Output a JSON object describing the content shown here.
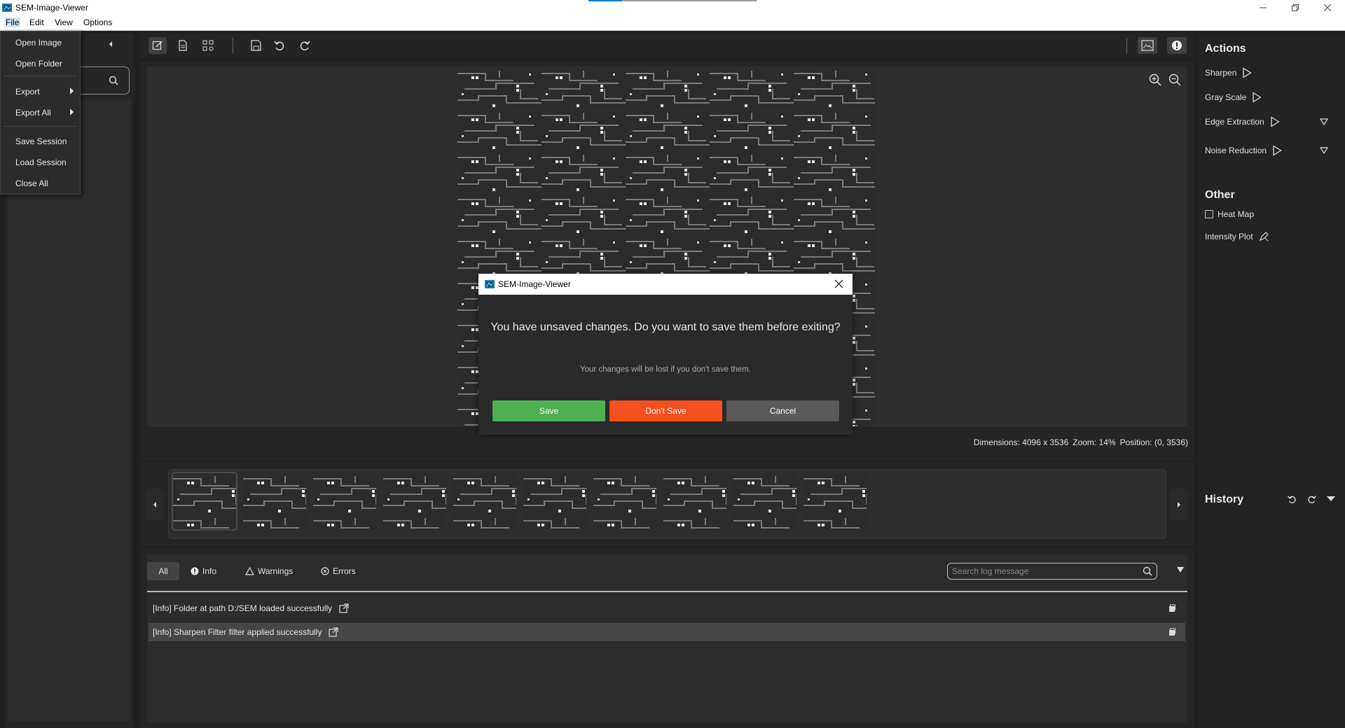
{
  "app": {
    "title": "SEM-Image-Viewer"
  },
  "menubar": {
    "items": [
      "File",
      "Edit",
      "View",
      "Options"
    ]
  },
  "file_menu": {
    "items": [
      "Open Image",
      "Open Folder",
      "Export",
      "Export All",
      "Save Session",
      "Load Session",
      "Close All"
    ]
  },
  "viewer": {
    "status": {
      "dimensions": "Dimensions: 4096 x 3536",
      "zoom": "Zoom: 14%",
      "position": "Position: (0, 3536)"
    }
  },
  "dialog": {
    "title": "SEM-Image-Viewer",
    "message": "You have unsaved changes. Do you want to save them before exiting?",
    "submessage": "Your changes will be lost if you don't save them.",
    "save_label": "Save",
    "dont_save_label": "Don't Save",
    "cancel_label": "Cancel",
    "colors": {
      "save": "#4caf50",
      "dont_save": "#f4511e",
      "cancel": "#5a5a5a"
    }
  },
  "log": {
    "tabs": {
      "all": "All",
      "info": "Info",
      "warnings": "Warnings",
      "errors": "Errors"
    },
    "search_placeholder": "Search log message",
    "rows": [
      "[Info] Folder at path D:/SEM loaded successfully",
      "[Info] Sharpen Filter filter applied successfully"
    ]
  },
  "right_panel": {
    "actions_title": "Actions",
    "actions": {
      "sharpen": "Sharpen",
      "gray_scale": "Gray Scale",
      "edge_extraction": "Edge Extraction",
      "noise_reduction": "Noise Reduction"
    },
    "other_title": "Other",
    "heat_map": "Heat Map",
    "intensity_plot": "Intensity Plot",
    "history_title": "History"
  },
  "thumbnails": {
    "count": 10
  }
}
